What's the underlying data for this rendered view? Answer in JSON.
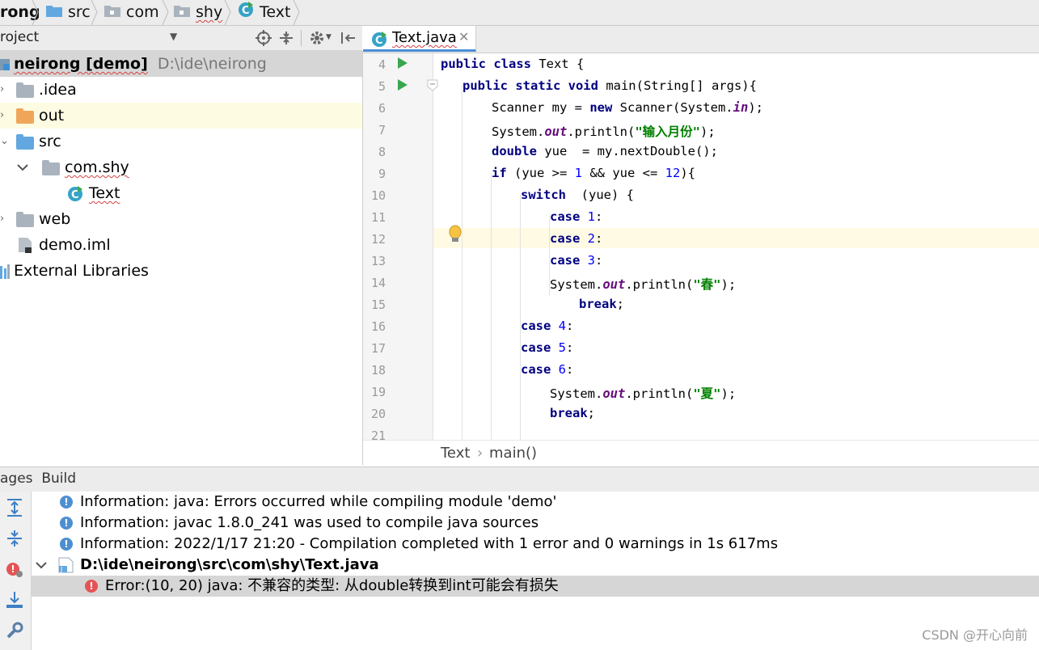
{
  "breadcrumb": {
    "items": [
      "rong",
      "src",
      "com",
      "shy",
      "Text"
    ]
  },
  "project": {
    "header_label": "roject",
    "tree": [
      {
        "label": "neirong [demo]",
        "path": "D:\\ide\\neirong"
      },
      {
        "label": ".idea"
      },
      {
        "label": "out"
      },
      {
        "label": "src"
      },
      {
        "label": "com.shy"
      },
      {
        "label": "Text"
      },
      {
        "label": "web"
      },
      {
        "label": "demo.iml"
      },
      {
        "label": "External Libraries"
      }
    ]
  },
  "editor": {
    "tab_label": "Text.java",
    "line_numbers": [
      "4",
      "5",
      "6",
      "7",
      "8",
      "9",
      "10",
      "11",
      "12",
      "13",
      "14",
      "15",
      "16",
      "17",
      "18",
      "19",
      "20",
      "21"
    ],
    "lines": [
      [
        "public class",
        " Text {"
      ],
      [
        "public static void",
        " main(String[] args){"
      ],
      [
        "Scanner my = ",
        "new",
        " Scanner(System.",
        "in",
        ");"
      ],
      [
        "System.",
        "out",
        ".println(",
        "\"输入月份\"",
        ");"
      ],
      [
        "double",
        " yue  = my.nextDouble();"
      ],
      [
        "if",
        " (yue >= ",
        "1",
        " && yue <= ",
        "12",
        "){"
      ],
      [
        "switch",
        "  (yue) {"
      ],
      [
        "case",
        " ",
        "1",
        ":"
      ],
      [
        "case",
        " ",
        "2",
        ":"
      ],
      [
        "case",
        " ",
        "3",
        ":"
      ],
      [
        "System.",
        "out",
        ".println(",
        "\"春\"",
        ");"
      ],
      [
        "break",
        ";"
      ],
      [
        "case",
        " ",
        "4",
        ":"
      ],
      [
        "case",
        " ",
        "5",
        ":"
      ],
      [
        "case",
        " ",
        "6",
        ":"
      ],
      [
        "System.",
        "out",
        ".println(",
        "\"夏\"",
        ");"
      ],
      [
        "break",
        ";"
      ],
      [
        ""
      ]
    ],
    "breadcrumb": {
      "class": "Text",
      "method": "main()"
    }
  },
  "build": {
    "header_label": "ages  Build",
    "messages": [
      {
        "type": "info",
        "text": "Information: java: Errors occurred while compiling module 'demo'"
      },
      {
        "type": "info",
        "text": "Information: javac 1.8.0_241 was used to compile java sources"
      },
      {
        "type": "info",
        "text": "Information: 2022/1/17 21:20 - Compilation completed with 1 error and 0 warnings in 1s 617ms"
      }
    ],
    "file": "D:\\ide\\neirong\\src\\com\\shy\\Text.java",
    "error": "Error:(10, 20)  java: 不兼容的类型: 从double转换到int可能会有损失"
  },
  "watermark": "CSDN @开心向前",
  "colors": {
    "keyword": "#000080",
    "number": "#0000ff",
    "string": "#008000",
    "field": "#660e7a",
    "info": "#4d8fd1",
    "error": "#e45454",
    "selection": "#d6d6d6"
  }
}
